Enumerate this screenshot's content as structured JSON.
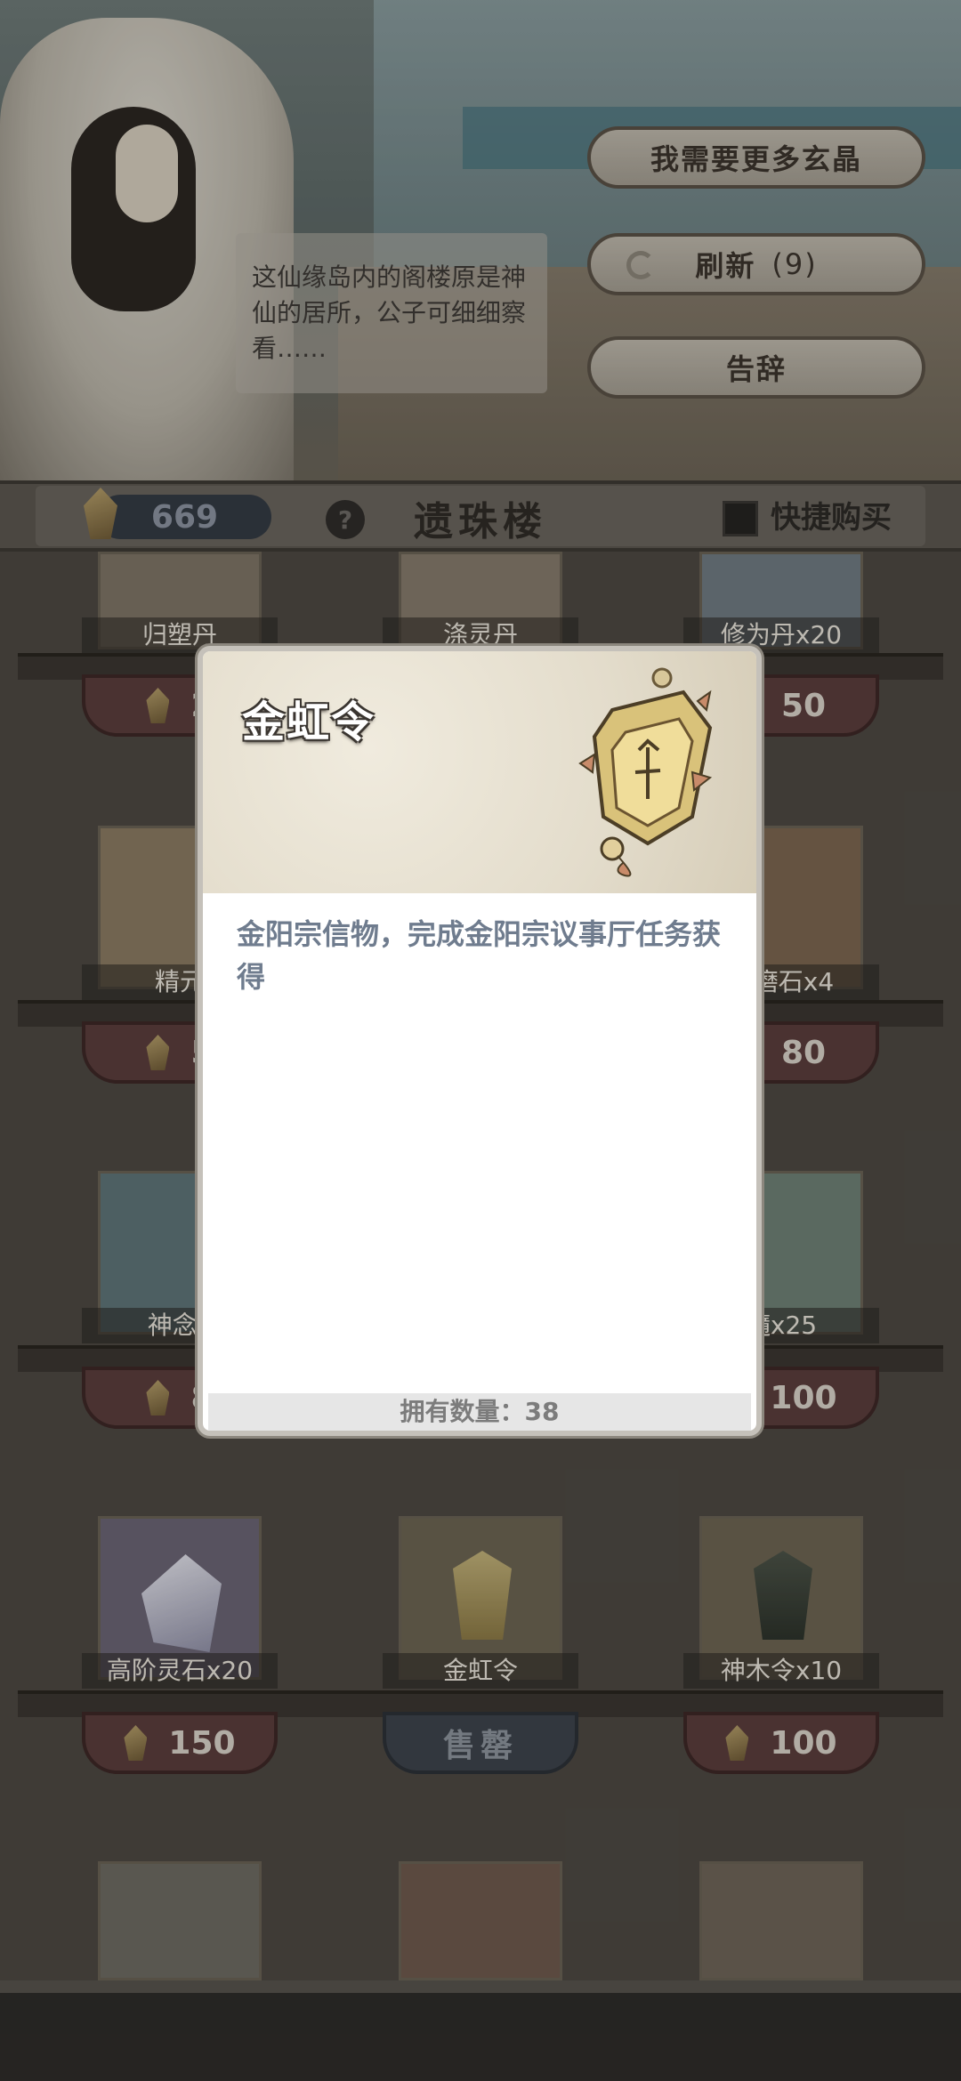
{
  "npc": {
    "speech": "这仙缘岛内的阁楼原是神仙的居所，公子可细细察看……"
  },
  "menu": {
    "more_crystals": "我需要更多玄晶",
    "refresh_label": "刷新",
    "refresh_count": "(9)",
    "farewell": "告辞"
  },
  "header": {
    "currency_amount": "669",
    "help": "?",
    "shop_title": "遗珠楼",
    "quick_buy": "快捷购买"
  },
  "shelves": {
    "row1": [
      {
        "label": "归塑丹",
        "price": "2"
      },
      {
        "label": "涤灵丹",
        "price": ""
      },
      {
        "label": "修为丹x20",
        "price": "50"
      }
    ],
    "row2": [
      {
        "label": "精元",
        "price": "5"
      },
      {
        "label": "",
        "price": ""
      },
      {
        "label": "打磨石x4",
        "price": "80"
      }
    ],
    "row3": [
      {
        "label": "神念x",
        "price": "8"
      },
      {
        "label": "",
        "price": ""
      },
      {
        "label": "髓x25",
        "price": "100"
      }
    ],
    "row4": [
      {
        "label": "高阶灵石x20",
        "price": "150"
      },
      {
        "label": "金虹令",
        "price": "售罄"
      },
      {
        "label": "神木令x10",
        "price": "100"
      }
    ]
  },
  "modal": {
    "title": "金虹令",
    "description": "金阳宗信物，完成金阳宗议事厅任务获得",
    "owned": "拥有数量：38"
  },
  "colors": {
    "accent": "#6f7c8e",
    "price_bg": "#5b3d3c",
    "sold_bg": "#3e444c"
  }
}
